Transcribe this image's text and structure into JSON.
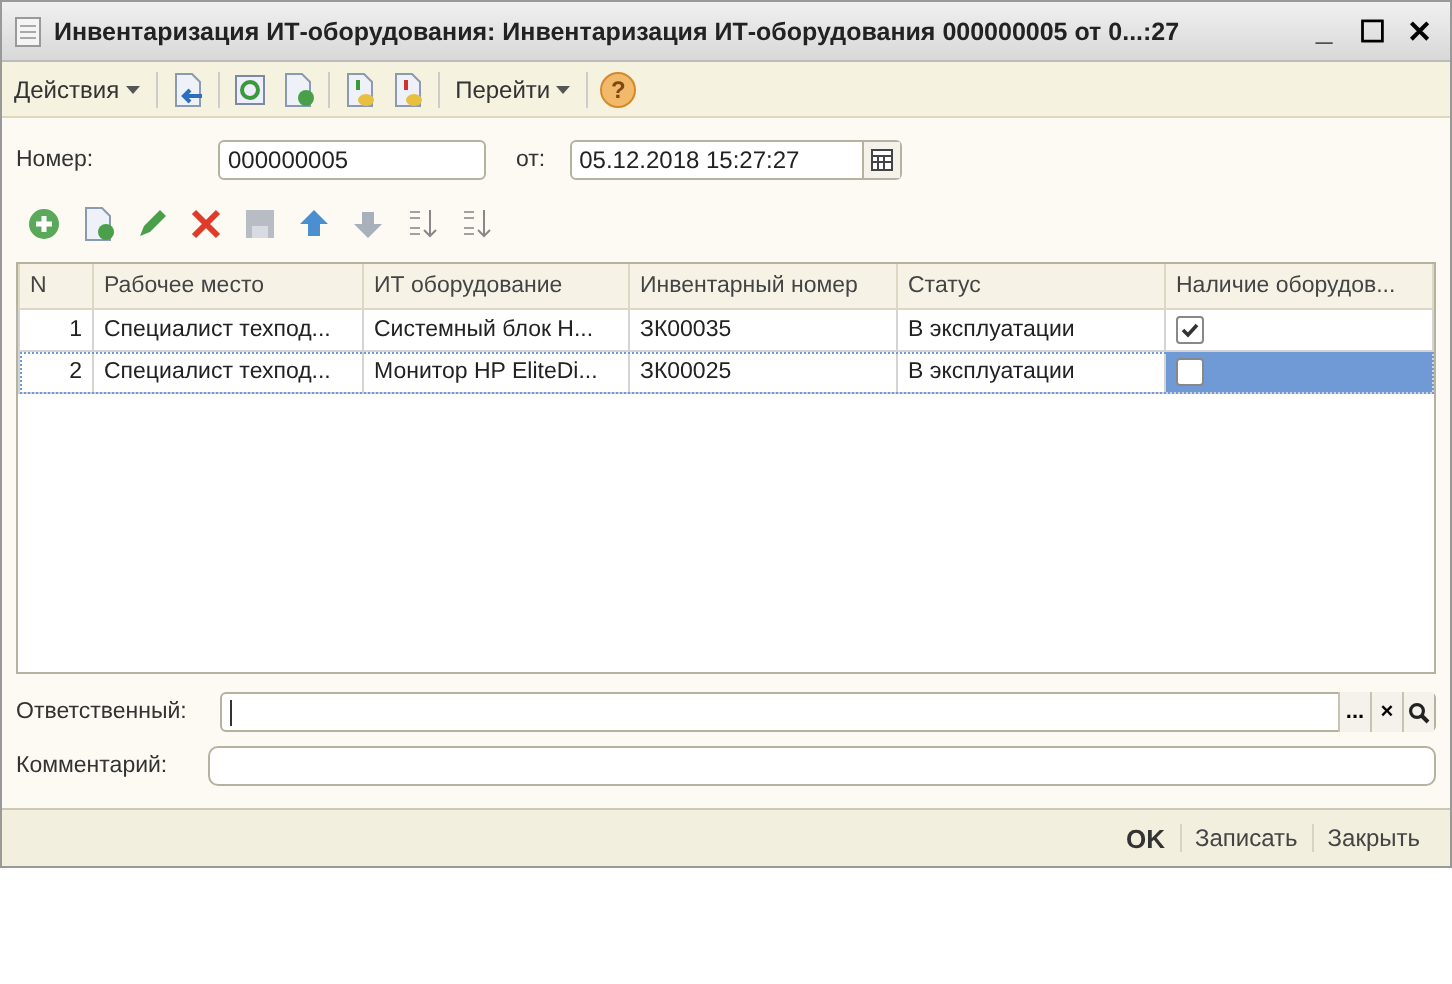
{
  "window": {
    "title": "Инвентаризация ИТ-оборудования: Инвентаризация ИТ-оборудования 000000005 от 0...:27",
    "controls": [
      "_",
      "☐",
      "✕"
    ]
  },
  "toolbar": {
    "actions": "Действия",
    "goto": "Перейти",
    "help": "?"
  },
  "header": {
    "number_label": "Номер:",
    "number": "000000005",
    "date_label": "от:",
    "date": "05.12.2018 15:27:27"
  },
  "table": {
    "columns": [
      "N",
      "Рабочее место",
      "ИТ оборудование",
      "Инвентарный номер",
      "Статус",
      "Наличие оборудов..."
    ],
    "rows": [
      {
        "n": "1",
        "workplace": "Специалист техпод...",
        "equipment": "Системный блок Н...",
        "inventory_number": "ЗК00035",
        "status": "В эксплуатации",
        "present": true,
        "selected": false
      },
      {
        "n": "2",
        "workplace": "Специалист техпод...",
        "equipment": "Монитор HP EliteDi...",
        "inventory_number": "ЗК00025",
        "status": "В эксплуатации",
        "present": false,
        "selected": true
      }
    ]
  },
  "responsible": {
    "label": "Ответственный:",
    "buttons": [
      "...",
      "×"
    ]
  },
  "comment": {
    "label": "Комментарий:"
  },
  "footer": {
    "buttons": [
      "OK",
      "Записать",
      "Закрыть"
    ]
  }
}
